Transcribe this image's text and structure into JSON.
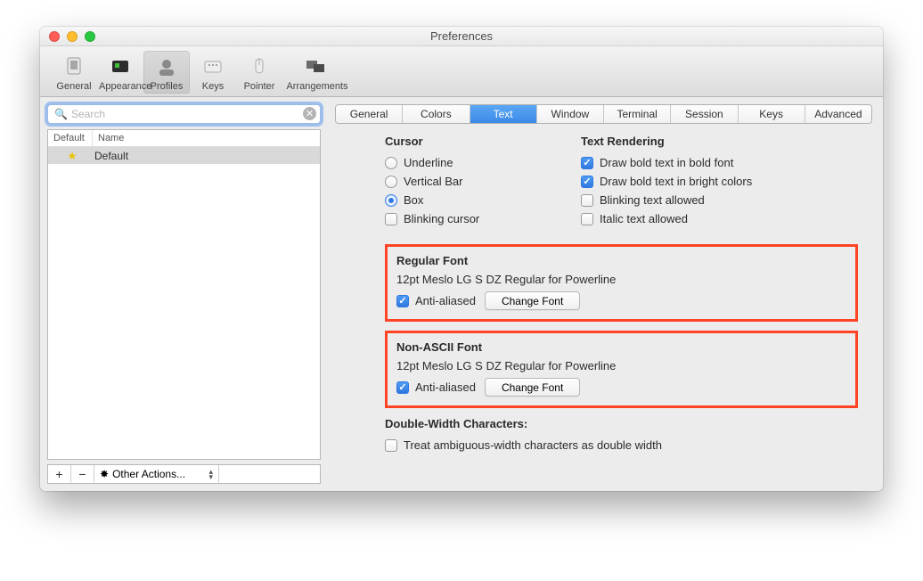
{
  "window": {
    "title": "Preferences"
  },
  "toolbar": {
    "items": [
      "General",
      "Appearance",
      "Profiles",
      "Keys",
      "Pointer",
      "Arrangements"
    ],
    "active": 2
  },
  "search": {
    "placeholder": "Search"
  },
  "profile_list": {
    "headers": {
      "default": "Default",
      "name": "Name"
    },
    "items": [
      {
        "name": "Default",
        "starred": true
      }
    ]
  },
  "bottombar": {
    "add": "+",
    "remove": "−",
    "other_label": "Other Actions..."
  },
  "tabs": {
    "items": [
      "General",
      "Colors",
      "Text",
      "Window",
      "Terminal",
      "Session",
      "Keys",
      "Advanced"
    ],
    "active": 2
  },
  "cursor": {
    "heading": "Cursor",
    "underline": "Underline",
    "vertical": "Vertical Bar",
    "box": "Box",
    "blinking": "Blinking cursor",
    "selected": "box",
    "blinking_checked": false
  },
  "text_rendering": {
    "heading": "Text Rendering",
    "bold_font": "Draw bold text in bold font",
    "bold_bright": "Draw bold text in bright colors",
    "blinking_text": "Blinking text allowed",
    "italic_text": "Italic text allowed",
    "bold_font_checked": true,
    "bold_bright_checked": true,
    "blinking_text_checked": false,
    "italic_text_checked": false
  },
  "regular_font": {
    "heading": "Regular Font",
    "desc": "12pt Meslo LG S DZ Regular for Powerline",
    "aa": "Anti-aliased",
    "aa_checked": true,
    "change": "Change Font"
  },
  "nonascii_font": {
    "heading": "Non-ASCII Font",
    "desc": "12pt Meslo LG S DZ Regular for Powerline",
    "aa": "Anti-aliased",
    "aa_checked": true,
    "change": "Change Font"
  },
  "double_width": {
    "heading": "Double-Width Characters:",
    "ambiguous": "Treat ambiguous-width characters as double width",
    "ambiguous_checked": false
  }
}
